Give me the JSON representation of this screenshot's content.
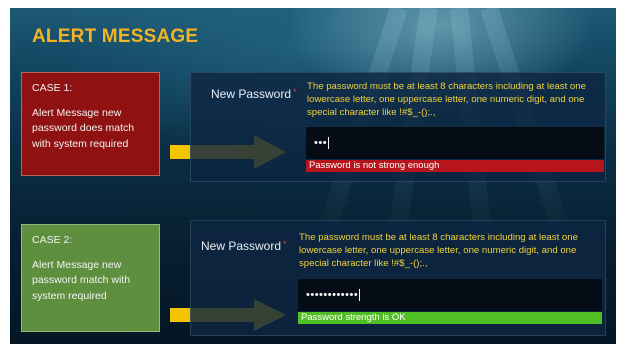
{
  "slide": {
    "title": "ALERT MESSAGE"
  },
  "colors": {
    "title": "#f2b425",
    "case_fail_bg": "#8f1111",
    "case_pass_bg": "#5e8f3e",
    "error_bar": "#b8141c",
    "success_bar": "#4fbf24",
    "rule_text": "#f0d23a",
    "arrow": "#f5c400"
  },
  "case1": {
    "heading": "CASE 1:",
    "description": "Alert Message new password does match with system required",
    "field_label": "New Password",
    "required_mark": "*",
    "rule": "The password must be at least 8 characters including at least one lowercase letter, one uppercase letter, one numeric digit, and one special character like !#$_-();.,",
    "input_value": "•••",
    "message": "Password is not strong enough",
    "arrow_icon": "right-arrow-icon"
  },
  "case2": {
    "heading": "CASE 2:",
    "description": "Alert Message new password match with system required",
    "field_label": "New Password",
    "required_mark": "*",
    "rule": "The password must be at least 8 characters including at least one lowercase letter, one uppercase letter, one numeric digit, and one special character like !#$_-();.,",
    "input_value": "••••••••••••",
    "message": "Password strength is OK",
    "arrow_icon": "right-arrow-icon"
  }
}
